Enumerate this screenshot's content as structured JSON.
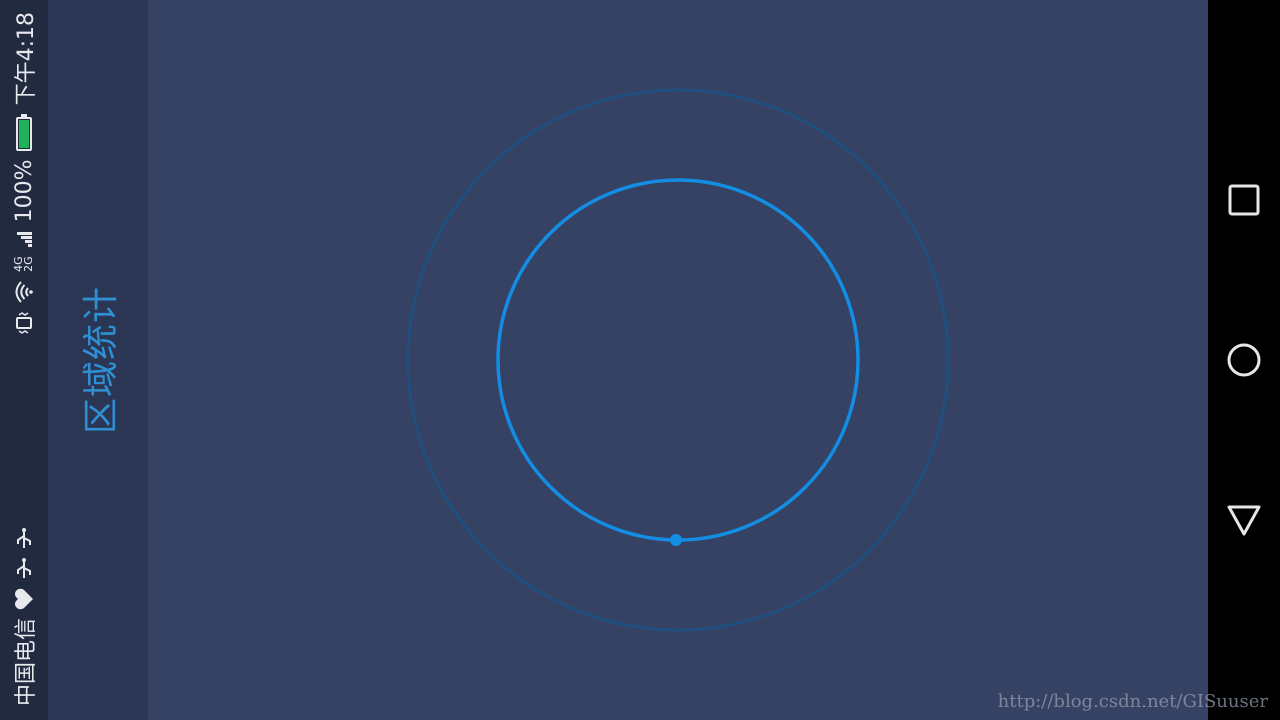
{
  "status_bar": {
    "carrier": "中国电信",
    "time": "下午4:18",
    "battery_percent": "100%",
    "battery_level": 1.0,
    "battery_color": "#1fb35a",
    "network_4g": "4G",
    "network_2g": "2G",
    "icons": [
      "usb-icon",
      "usb-icon",
      "heart-icon",
      "vibrate-icon",
      "wifi-icon",
      "signal-icon",
      "signal-icon",
      "battery-icon"
    ]
  },
  "side_panel": {
    "title": "区域统计"
  },
  "radar": {
    "outer_ring_color": "#1e4f7e",
    "inner_ring_color": "#138ee4",
    "dot_color": "#138ee4"
  },
  "nav_bar": {
    "buttons": [
      "recent-apps-icon",
      "home-icon",
      "back-icon"
    ]
  },
  "watermark": {
    "text": "http://blog.csdn.net/GISuuser"
  }
}
